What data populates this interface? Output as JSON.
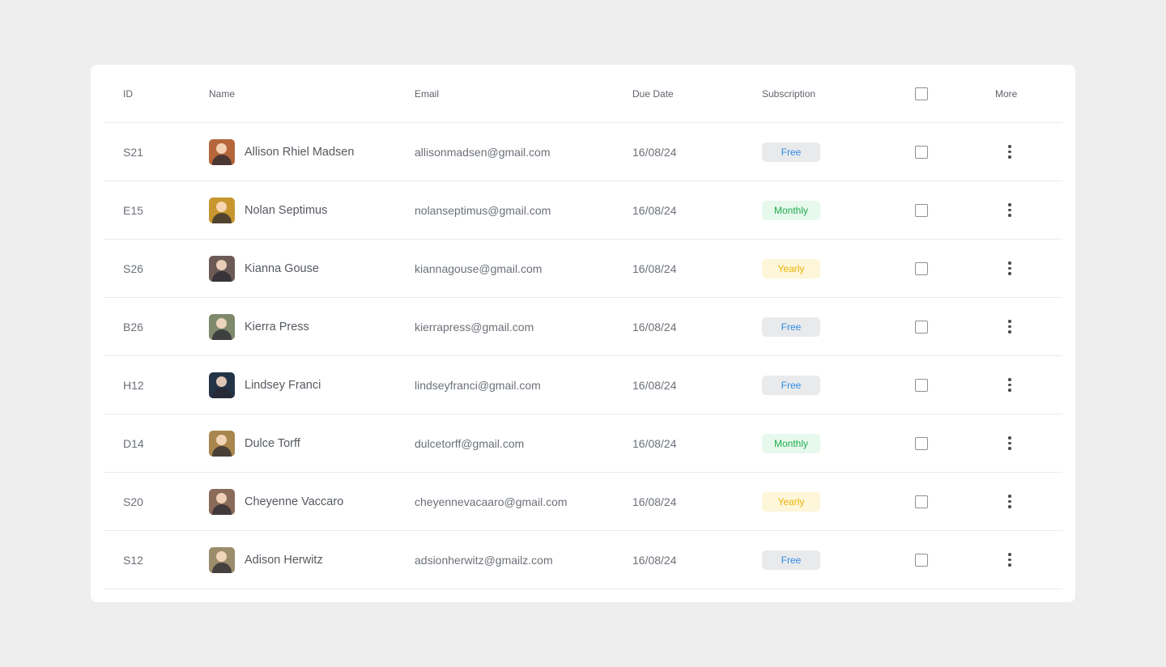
{
  "table": {
    "headers": {
      "id": "ID",
      "name": "Name",
      "email": "Email",
      "due_date": "Due Date",
      "subscription": "Subscription",
      "more": "More"
    },
    "colors": {
      "free": "#2f8be6",
      "monthly": "#1fae4f",
      "yearly": "#eab308"
    },
    "rows": [
      {
        "id": "S21",
        "name": "Allison Rhiel Madsen",
        "email": "allisonmadsen@gmail.com",
        "due_date": "16/08/24",
        "subscription": "Free",
        "type": "free",
        "checked": false,
        "avatar_color": "#b5663a"
      },
      {
        "id": "E15",
        "name": "Nolan Septimus",
        "email": "nolanseptimus@gmail.com",
        "due_date": "16/08/24",
        "subscription": "Monthly",
        "type": "monthly",
        "checked": false,
        "avatar_color": "#c8962f"
      },
      {
        "id": "S26",
        "name": "Kianna Gouse",
        "email": "kiannagouse@gmail.com",
        "due_date": "16/08/24",
        "subscription": "Yearly",
        "type": "yearly",
        "checked": false,
        "avatar_color": "#6b5a55"
      },
      {
        "id": "B26",
        "name": "Kierra Press",
        "email": "kierrapress@gmail.com",
        "due_date": "16/08/24",
        "subscription": "Free",
        "type": "free",
        "checked": false,
        "avatar_color": "#7f8a6c"
      },
      {
        "id": "H12",
        "name": "Lindsey Franci",
        "email": "lindseyfranci@gmail.com",
        "due_date": "16/08/24",
        "subscription": "Free",
        "type": "free",
        "checked": false,
        "avatar_color": "#243447"
      },
      {
        "id": "D14",
        "name": "Dulce Torff",
        "email": "dulcetorff@gmail.com",
        "due_date": "16/08/24",
        "subscription": "Monthly",
        "type": "monthly",
        "checked": false,
        "avatar_color": "#a8864e"
      },
      {
        "id": "S20",
        "name": "Cheyenne Vaccaro",
        "email": "cheyennevacaaro@gmail.com",
        "due_date": "16/08/24",
        "subscription": "Yearly",
        "type": "yearly",
        "checked": false,
        "avatar_color": "#8a6b5a"
      },
      {
        "id": "S12",
        "name": "Adison Herwitz",
        "email": "adsionherwitz@gmailz.com",
        "due_date": "16/08/24",
        "subscription": "Free",
        "type": "free",
        "checked": false,
        "avatar_color": "#9b8c6b"
      }
    ]
  }
}
